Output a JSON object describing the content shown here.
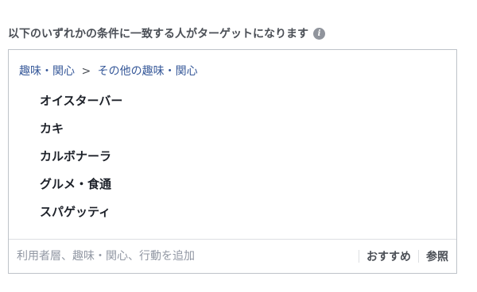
{
  "header": {
    "title": "以下のいずれかの条件に一致する人がターゲットになります",
    "info_icon": "info-icon"
  },
  "targeting": {
    "breadcrumb": {
      "category": "趣味・関心",
      "separator": ">",
      "subcategory": "その他の趣味・関心"
    },
    "items": [
      {
        "label": "オイスターバー"
      },
      {
        "label": "カキ"
      },
      {
        "label": "カルボナーラ"
      },
      {
        "label": "グルメ・食通"
      },
      {
        "label": "スパゲッティ"
      }
    ],
    "input": {
      "placeholder": "利用者層、趣味・関心、行動を追加",
      "value": ""
    },
    "actions": {
      "suggestions": "おすすめ",
      "browse": "参照"
    }
  },
  "colors": {
    "link": "#365899",
    "text": "#1d2129",
    "muted": "#4b4f56",
    "placeholder": "#9197a3",
    "border": "#bec3c9"
  }
}
